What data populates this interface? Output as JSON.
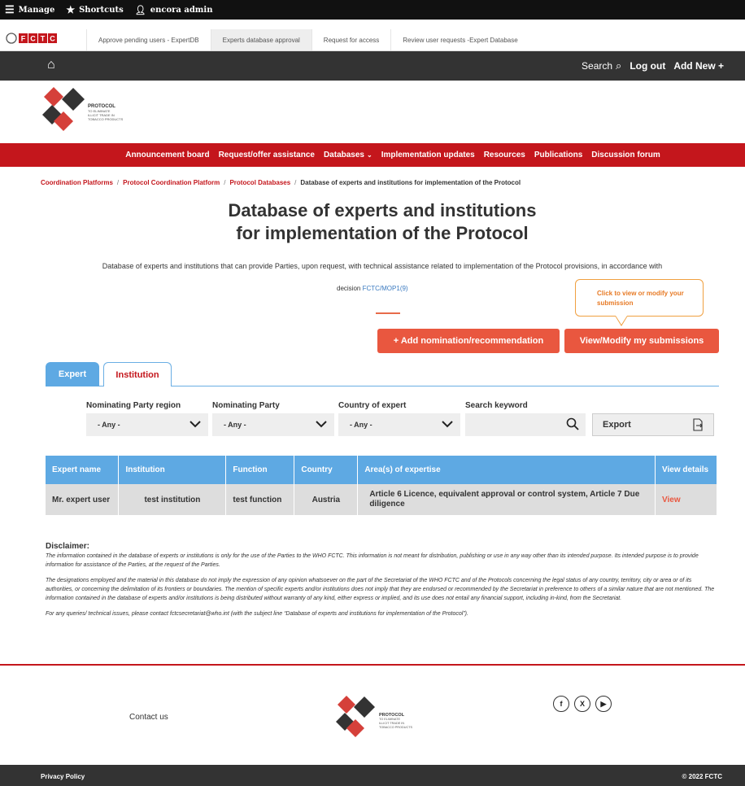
{
  "admin_bar": {
    "manage": "Manage",
    "shortcuts": "Shortcuts",
    "user": "encora admin"
  },
  "tabs_bar": [
    "Approve pending users - ExpertDB",
    "Experts database approval",
    "Request for access",
    "Review user requests -Expert Database"
  ],
  "top_bar": {
    "search": "Search",
    "logout": "Log out",
    "add_new": "Add New +"
  },
  "logo_text": [
    "PROTOCOL",
    "TO ELIMINATE",
    "ILLICIT TRADE IN",
    "TOBACCO PRODUCTS"
  ],
  "nav": [
    "Announcement board",
    "Request/offer assistance",
    "Databases",
    "Implementation updates",
    "Resources",
    "Publications",
    "Discussion forum"
  ],
  "breadcrumb": [
    "Coordination Platforms",
    "Protocol Coordination Platform",
    "Protocol Databases",
    "Database of experts and institutions for implementation of the Protocol"
  ],
  "title_line1": "Database of experts and institutions",
  "title_line2": "for implementation of the Protocol",
  "description": "Database of experts and institutions that can provide Parties, upon request, with technical assistance related to implementation of the Protocol provisions, in accordance with",
  "decision_prefix": "decision",
  "decision_link": "FCTC/MOP1(9)",
  "callout_text": "Click to view or modify your submission",
  "buttons": {
    "add": "+ Add nomination/recommendation",
    "view": "View/Modify my submissions"
  },
  "tabs": {
    "expert": "Expert",
    "institution": "Institution"
  },
  "filters": {
    "region_label": "Nominating Party region",
    "party_label": "Nominating Party",
    "country_label": "Country of expert",
    "keyword_label": "Search keyword",
    "any": "- Any -",
    "export": "Export"
  },
  "table": {
    "headers": [
      "Expert name",
      "Institution",
      "Function",
      "Country",
      "Area(s) of expertise",
      "View details"
    ],
    "rows": [
      [
        "Mr. expert user",
        "test institution",
        "test function",
        "Austria",
        "Article 6 Licence, equivalent approval or control system, Article 7 Due diligence",
        "View"
      ]
    ]
  },
  "disclaimer": {
    "title": "Disclaimer:",
    "p1": "The information contained in the database of experts or institutions is only for the use of the Parties to the WHO FCTC. This information is not meant for distribution, publishing or use in any way other than its intended purpose. Its intended purpose is to provide information for assistance of the Parties, at the request of the Parties.",
    "p2": "The designations employed and the material in this database do not imply the expression of any opinion whatsoever on the part of the Secretariat of the WHO FCTC and of the Protocols concerning the legal status of any country, territory, city or area or of its authorities, or concerning the delimitation of its frontiers or boundaries. The mention of specific experts and/or institutions does not imply that they are endorsed or recommended by the Secretariat in preference to others of a similar nature that are not mentioned. The information contained in the database of experts and/or institutions is being distributed without warranty of any kind, either express or implied, and its use does not entail any financial support, including in-kind, from the Secretariat.",
    "p3": "For any queries/ technical issues, please contact fctcsecretariat@who.int (with the subject line “Database of experts and institutions for implementation of the Protocol”)."
  },
  "footer": {
    "contact": "Contact us",
    "privacy": "Privacy Policy",
    "copyright": "© 2022 FCTC"
  },
  "colors": {
    "red": "#c4161c",
    "blue": "#5ea9e3",
    "orange": "#e9573f"
  }
}
